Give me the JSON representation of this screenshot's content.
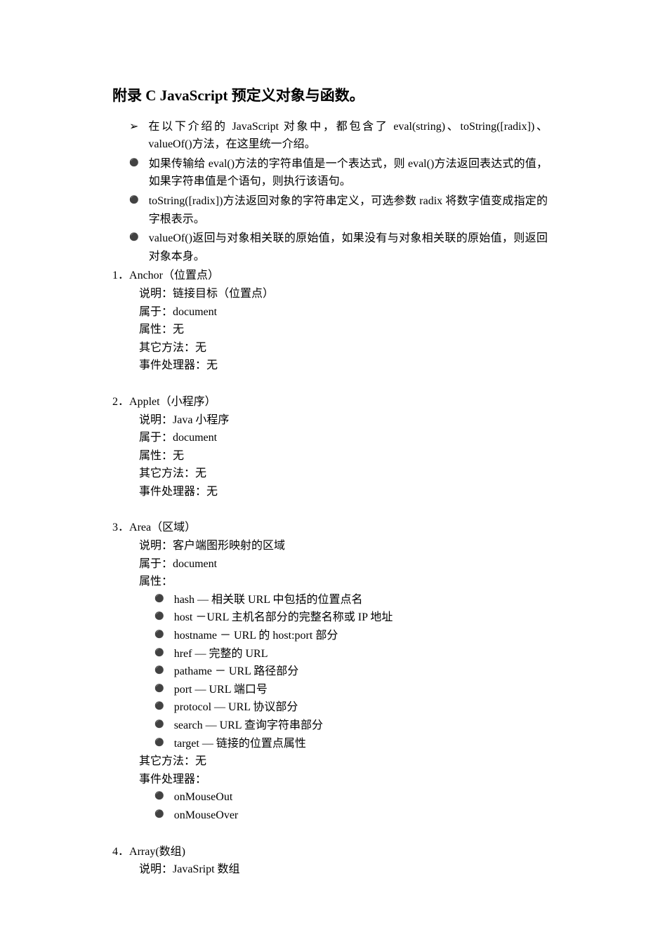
{
  "title": "附录 C    JavaScript 预定义对象与函数。",
  "intro": [
    {
      "bullet": "arrow",
      "text": "在以下介绍的 JavaScript 对象中，都包含了 eval(string)、toString([radix])、valueOf()方法，在这里统一介绍。"
    },
    {
      "bullet": "disc",
      "text": "如果传输给 eval()方法的字符串值是一个表达式，则 eval()方法返回表达式的值，如果字符串值是个语句，则执行该语句。"
    },
    {
      "bullet": "disc",
      "text": "toString([radix])方法返回对象的字符串定义，可选参数 radix 将数字值变成指定的字根表示。"
    },
    {
      "bullet": "disc",
      "text": "valueOf()返回与对象相关联的原始值，如果没有与对象相关联的原始值，则返回对象本身。"
    }
  ],
  "entries": [
    {
      "num": "1．",
      "name": "Anchor（位置点）",
      "lines": [
        "说明：链接目标（位置点）",
        "属于：document",
        "属性：无",
        "其它方法：无",
        "事件处理器：无"
      ]
    },
    {
      "num": "2．",
      "name": "Applet（小程序）",
      "lines": [
        "说明：Java 小程序",
        "属于：document",
        "属性：无",
        "其它方法：无",
        "事件处理器：无"
      ]
    },
    {
      "num": "3．",
      "name": "Area（区域）",
      "lines": [
        "说明：客户端图形映射的区域",
        "属于：document",
        "属性："
      ],
      "sublist1": [
        "hash — 相关联 URL 中包括的位置点名",
        "host －URL 主机名部分的完整名称或 IP 地址",
        "hostname － URL 的 host:port 部分",
        "href — 完整的 URL",
        "pathame － URL 路径部分",
        "port — URL 端口号",
        "protocol — URL 协议部分",
        "search — URL 查询字符串部分",
        "target —  链接的位置点属性"
      ],
      "lines2": [
        "其它方法：无",
        "事件处理器："
      ],
      "sublist2": [
        "onMouseOut",
        "onMouseOver"
      ]
    },
    {
      "num": "4．",
      "name": "Array(数组)",
      "lines": [
        "说明：JavaSript 数组"
      ]
    }
  ]
}
